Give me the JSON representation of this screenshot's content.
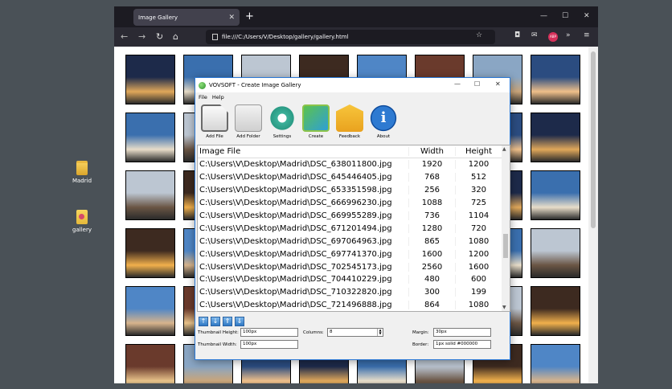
{
  "desktop": {
    "icons": [
      {
        "label": "Madrid",
        "icon": "folder-icon"
      },
      {
        "label": "gallery",
        "icon": "html-file-icon"
      }
    ]
  },
  "browser": {
    "tab_title": "Image Gallery",
    "new_tab": "+",
    "url": "file:///C:/Users/V/Desktop/gallery/gallery.html",
    "avatar_text": "ABP",
    "min": "—",
    "max": "☐",
    "close": "✕"
  },
  "app": {
    "title": "VOVSOFT - Create Image Gallery",
    "menu": [
      "File",
      "Help"
    ],
    "toolbar": [
      {
        "label": "Add File",
        "icon": "add-file-icon"
      },
      {
        "label": "Add Folder",
        "icon": "add-folder-icon"
      },
      {
        "label": "Settings",
        "icon": "settings-gear-icon"
      },
      {
        "label": "Create",
        "icon": "create-gallery-icon"
      },
      {
        "label": "Feedback",
        "icon": "feedback-envelope-icon"
      },
      {
        "label": "About",
        "icon": "about-info-icon"
      }
    ],
    "table": {
      "headers": [
        "Image File",
        "Width",
        "Height"
      ],
      "rows": [
        [
          "C:\\Users\\V\\Desktop\\Madrid\\DSC_638011800.jpg",
          "1920",
          "1200"
        ],
        [
          "C:\\Users\\V\\Desktop\\Madrid\\DSC_645446405.jpg",
          "768",
          "512"
        ],
        [
          "C:\\Users\\V\\Desktop\\Madrid\\DSC_653351598.jpg",
          "256",
          "320"
        ],
        [
          "C:\\Users\\V\\Desktop\\Madrid\\DSC_666996230.jpg",
          "1088",
          "725"
        ],
        [
          "C:\\Users\\V\\Desktop\\Madrid\\DSC_669955289.jpg",
          "736",
          "1104"
        ],
        [
          "C:\\Users\\V\\Desktop\\Madrid\\DSC_671201494.jpg",
          "1280",
          "720"
        ],
        [
          "C:\\Users\\V\\Desktop\\Madrid\\DSC_697064963.jpg",
          "865",
          "1080"
        ],
        [
          "C:\\Users\\V\\Desktop\\Madrid\\DSC_697741370.jpg",
          "1600",
          "1200"
        ],
        [
          "C:\\Users\\V\\Desktop\\Madrid\\DSC_702545173.jpg",
          "2560",
          "1600"
        ],
        [
          "C:\\Users\\V\\Desktop\\Madrid\\DSC_704410229.jpg",
          "480",
          "600"
        ],
        [
          "C:\\Users\\V\\Desktop\\Madrid\\DSC_710322820.jpg",
          "300",
          "199"
        ],
        [
          "C:\\Users\\V\\Desktop\\Madrid\\DSC_721496888.jpg",
          "864",
          "1080"
        ]
      ]
    },
    "fields": {
      "thumb_height_label": "Thumbnail Height:",
      "thumb_height": "100px",
      "thumb_width_label": "Thumbnail Width:",
      "thumb_width": "100px",
      "columns_label": "Columns:",
      "columns": "8",
      "margin_label": "Margin:",
      "margin": "30px",
      "border_label": "Border:",
      "border": "1px solid #000000"
    }
  },
  "colors": {
    "accent": "#2b79d6",
    "browser_bg": "#1c1b22",
    "desktop_bg": "#4a5157"
  }
}
